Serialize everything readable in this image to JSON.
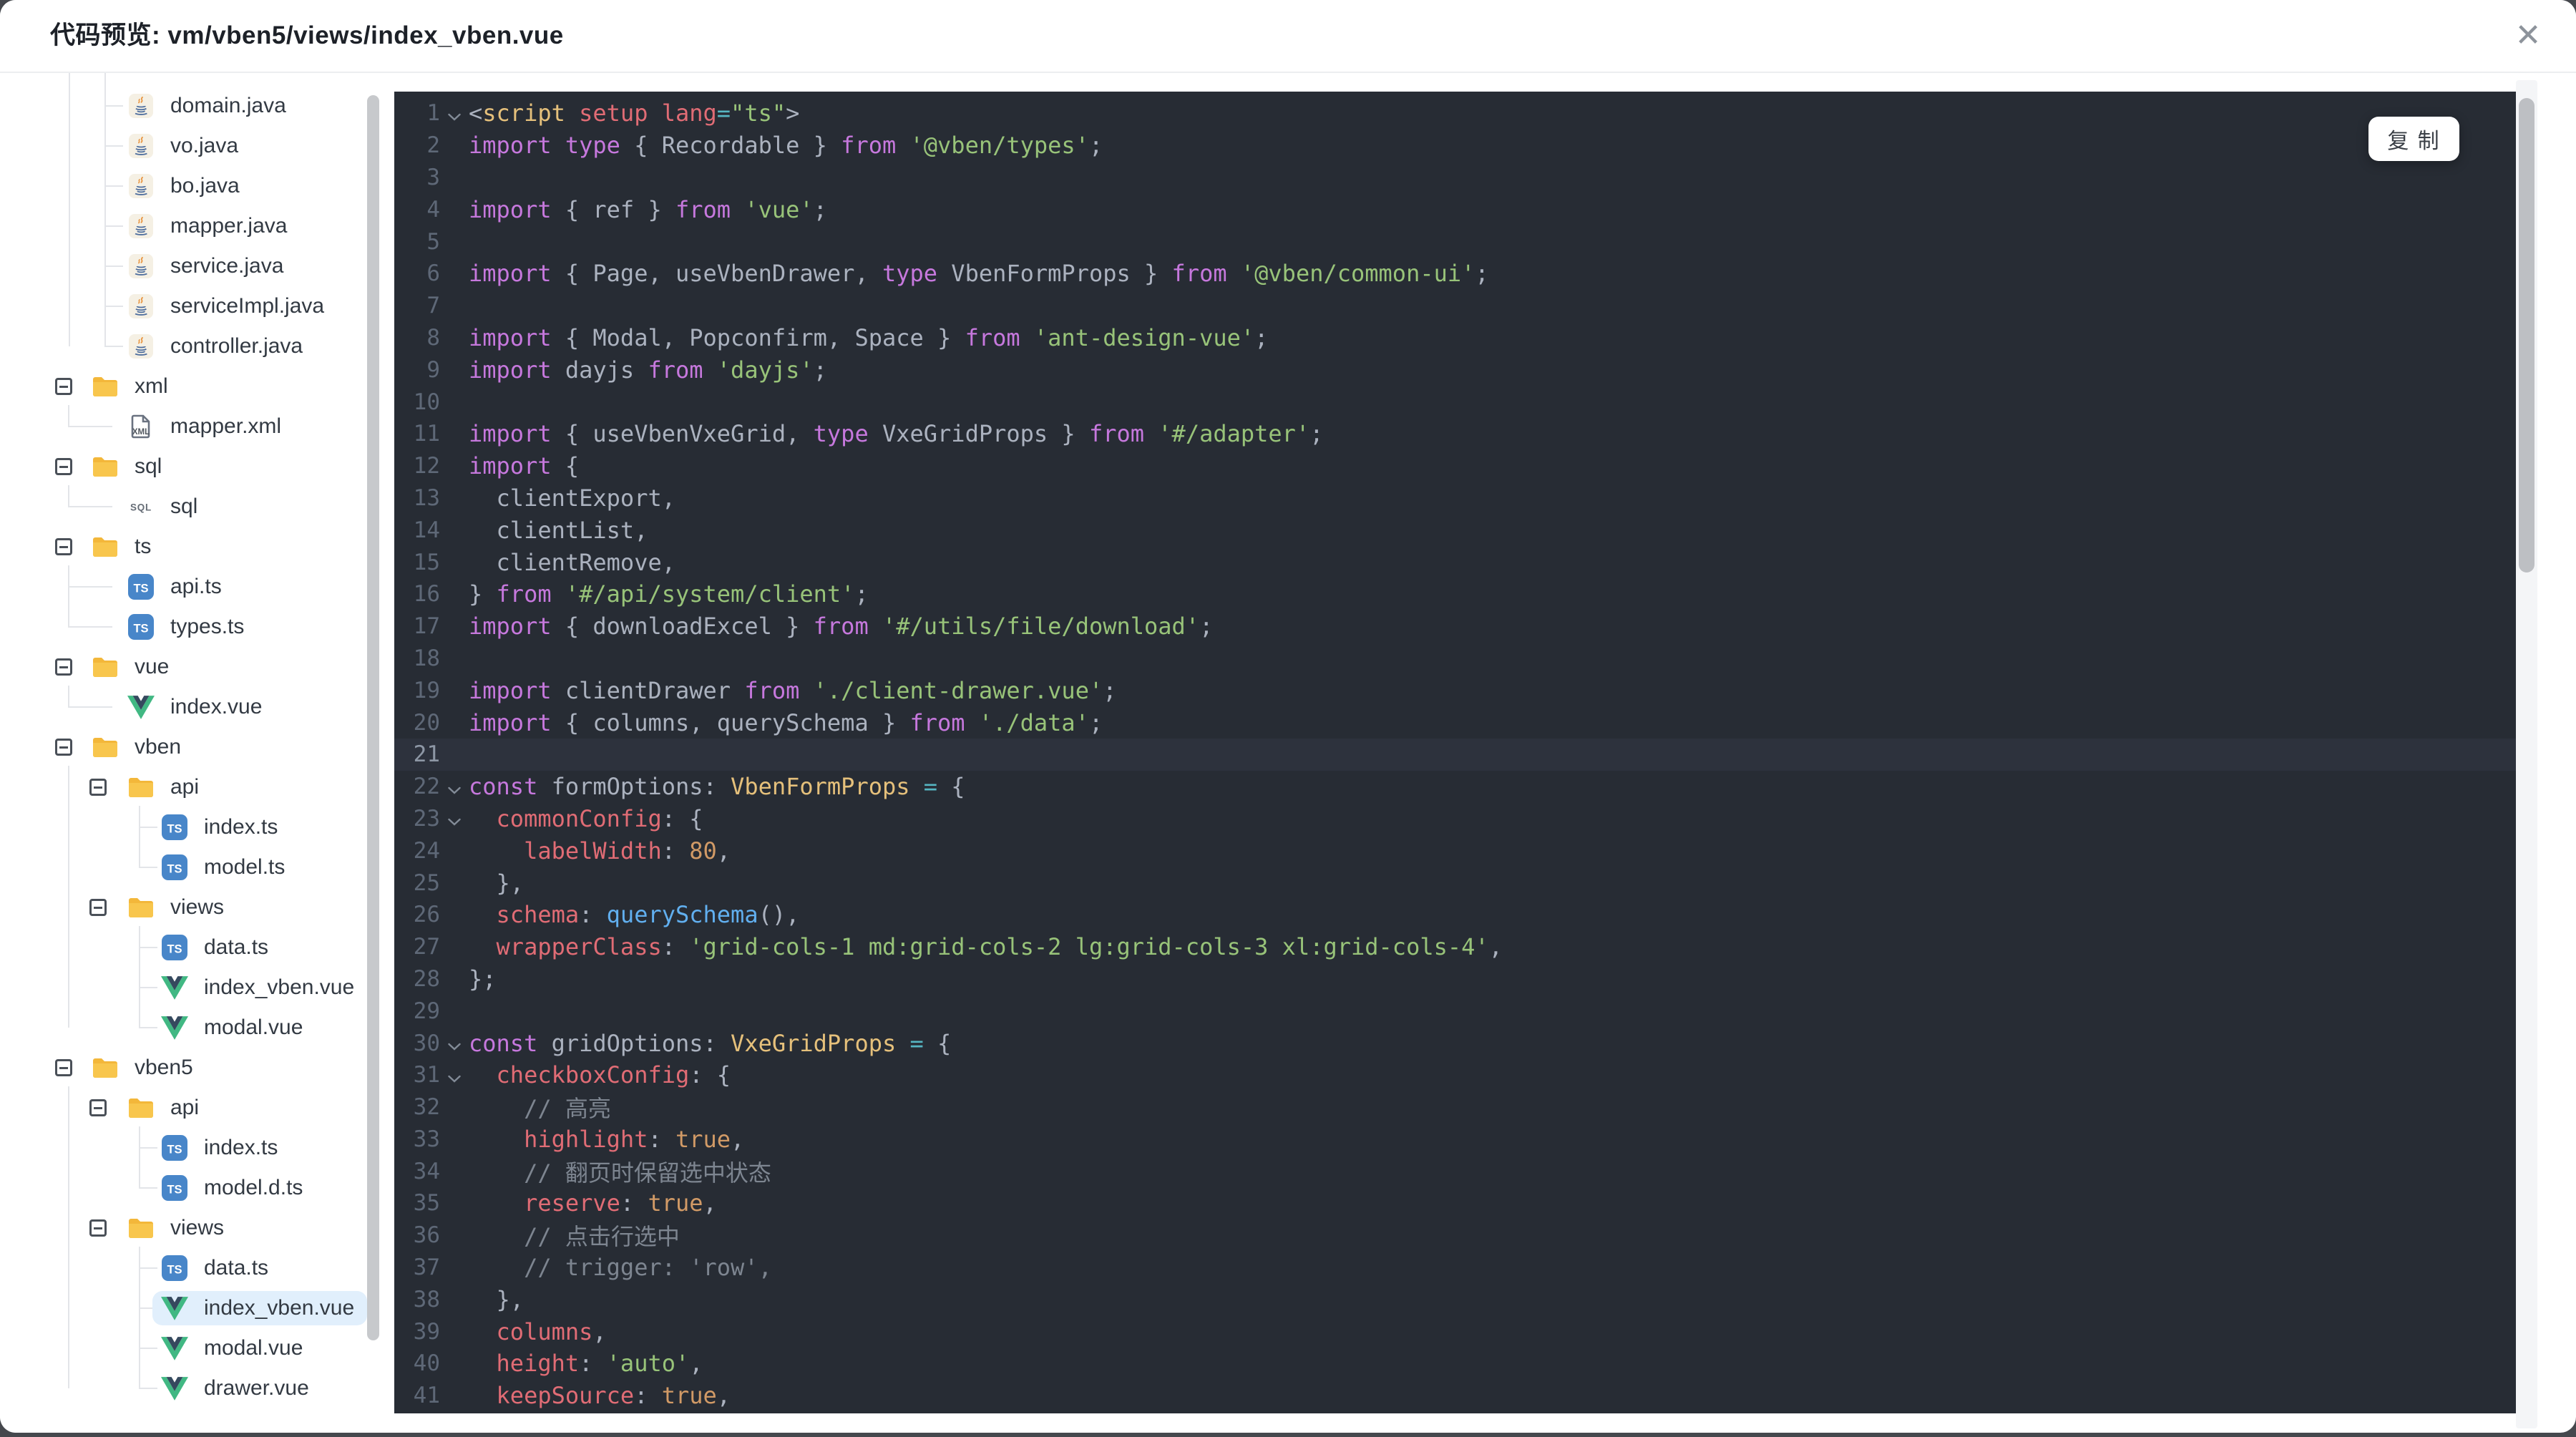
{
  "dialog": {
    "title": "代码预览: vm/vben5/views/index_vben.vue",
    "close_icon": "✕"
  },
  "copy_button": {
    "label": "复 制"
  },
  "tree": {
    "selected_bg": "#e1effc",
    "folder_color": "#f7c33c",
    "ts_color": "#4886c9",
    "vue_colors": {
      "outer": "#41b883",
      "inner": "#35495e"
    },
    "items": [
      {
        "name": "domain.java",
        "icon": "java",
        "depth": 1,
        "type": "file"
      },
      {
        "name": "vo.java",
        "icon": "java",
        "depth": 1,
        "type": "file"
      },
      {
        "name": "bo.java",
        "icon": "java",
        "depth": 1,
        "type": "file"
      },
      {
        "name": "mapper.java",
        "icon": "java",
        "depth": 1,
        "type": "file"
      },
      {
        "name": "service.java",
        "icon": "java",
        "depth": 1,
        "type": "file"
      },
      {
        "name": "serviceImpl.java",
        "icon": "java",
        "depth": 1,
        "type": "file"
      },
      {
        "name": "controller.java",
        "icon": "java",
        "depth": 1,
        "type": "file"
      },
      {
        "name": "xml",
        "icon": "folder",
        "depth": 0,
        "type": "folder",
        "toggle": true
      },
      {
        "name": "mapper.xml",
        "icon": "xml",
        "depth": 1,
        "type": "file"
      },
      {
        "name": "sql",
        "icon": "folder",
        "depth": 0,
        "type": "folder",
        "toggle": true
      },
      {
        "name": "sql",
        "icon": "sql",
        "depth": 1,
        "type": "file"
      },
      {
        "name": "ts",
        "icon": "folder",
        "depth": 0,
        "type": "folder",
        "toggle": true
      },
      {
        "name": "api.ts",
        "icon": "ts",
        "depth": 1,
        "type": "file"
      },
      {
        "name": "types.ts",
        "icon": "ts",
        "depth": 1,
        "type": "file"
      },
      {
        "name": "vue",
        "icon": "folder",
        "depth": 0,
        "type": "folder",
        "toggle": true
      },
      {
        "name": "index.vue",
        "icon": "vue",
        "depth": 1,
        "type": "file"
      },
      {
        "name": "vben",
        "icon": "folder",
        "depth": 0,
        "type": "folder",
        "toggle": true
      },
      {
        "name": "api",
        "icon": "folder",
        "depth": 1,
        "type": "folder",
        "toggle": true
      },
      {
        "name": "index.ts",
        "icon": "ts",
        "depth": 2,
        "type": "file"
      },
      {
        "name": "model.ts",
        "icon": "ts",
        "depth": 2,
        "type": "file"
      },
      {
        "name": "views",
        "icon": "folder",
        "depth": 1,
        "type": "folder",
        "toggle": true
      },
      {
        "name": "data.ts",
        "icon": "ts",
        "depth": 2,
        "type": "file"
      },
      {
        "name": "index_vben.vue",
        "icon": "vue",
        "depth": 2,
        "type": "file"
      },
      {
        "name": "modal.vue",
        "icon": "vue",
        "depth": 2,
        "type": "file"
      },
      {
        "name": "vben5",
        "icon": "folder",
        "depth": 0,
        "type": "folder",
        "toggle": true
      },
      {
        "name": "api",
        "icon": "folder",
        "depth": 1,
        "type": "folder",
        "toggle": true
      },
      {
        "name": "index.ts",
        "icon": "ts",
        "depth": 2,
        "type": "file"
      },
      {
        "name": "model.d.ts",
        "icon": "ts",
        "depth": 2,
        "type": "file"
      },
      {
        "name": "views",
        "icon": "folder",
        "depth": 1,
        "type": "folder",
        "toggle": true
      },
      {
        "name": "data.ts",
        "icon": "ts",
        "depth": 2,
        "type": "file"
      },
      {
        "name": "index_vben.vue",
        "icon": "vue",
        "depth": 2,
        "type": "file",
        "selected": true
      },
      {
        "name": "modal.vue",
        "icon": "vue",
        "depth": 2,
        "type": "file"
      },
      {
        "name": "drawer.vue",
        "icon": "vue",
        "depth": 2,
        "type": "file"
      }
    ]
  },
  "editor": {
    "background": "#272c34",
    "line_highlight": "#2d323d",
    "colors": {
      "p": "#c678dd",
      "t": "#abb2bf",
      "s": "#98c379",
      "r": "#e06c75",
      "y": "#e5c07b",
      "c": "#56b6c2",
      "b": "#61afef",
      "o": "#d19a66",
      "m": "#7d8590",
      "ln": "#5e6877"
    },
    "lines": [
      {
        "fold": true,
        "tokens": [
          [
            "t",
            "<"
          ],
          [
            "y",
            "script"
          ],
          [
            "t",
            " "
          ],
          [
            "r",
            "setup"
          ],
          [
            "t",
            " "
          ],
          [
            "r",
            "lang"
          ],
          [
            "c",
            "="
          ],
          [
            "s",
            "\"ts\""
          ],
          [
            "t",
            ">"
          ]
        ]
      },
      {
        "tokens": [
          [
            "p",
            "import"
          ],
          [
            "t",
            " "
          ],
          [
            "p",
            "type"
          ],
          [
            "t",
            " { Recordable } "
          ],
          [
            "p",
            "from"
          ],
          [
            "t",
            " "
          ],
          [
            "s",
            "'@vben/types'"
          ],
          [
            "t",
            ";"
          ]
        ]
      },
      {
        "tokens": []
      },
      {
        "tokens": [
          [
            "p",
            "import"
          ],
          [
            "t",
            " { ref } "
          ],
          [
            "p",
            "from"
          ],
          [
            "t",
            " "
          ],
          [
            "s",
            "'vue'"
          ],
          [
            "t",
            ";"
          ]
        ]
      },
      {
        "tokens": []
      },
      {
        "tokens": [
          [
            "p",
            "import"
          ],
          [
            "t",
            " { Page, useVbenDrawer, "
          ],
          [
            "p",
            "type"
          ],
          [
            "t",
            " VbenFormProps } "
          ],
          [
            "p",
            "from"
          ],
          [
            "t",
            " "
          ],
          [
            "s",
            "'@vben/common-ui'"
          ],
          [
            "t",
            ";"
          ]
        ]
      },
      {
        "tokens": []
      },
      {
        "tokens": [
          [
            "p",
            "import"
          ],
          [
            "t",
            " { Modal, Popconfirm, Space } "
          ],
          [
            "p",
            "from"
          ],
          [
            "t",
            " "
          ],
          [
            "s",
            "'ant-design-vue'"
          ],
          [
            "t",
            ";"
          ]
        ]
      },
      {
        "tokens": [
          [
            "p",
            "import"
          ],
          [
            "t",
            " dayjs "
          ],
          [
            "p",
            "from"
          ],
          [
            "t",
            " "
          ],
          [
            "s",
            "'dayjs'"
          ],
          [
            "t",
            ";"
          ]
        ]
      },
      {
        "tokens": []
      },
      {
        "tokens": [
          [
            "p",
            "import"
          ],
          [
            "t",
            " { useVbenVxeGrid, "
          ],
          [
            "p",
            "type"
          ],
          [
            "t",
            " VxeGridProps } "
          ],
          [
            "p",
            "from"
          ],
          [
            "t",
            " "
          ],
          [
            "s",
            "'#/adapter'"
          ],
          [
            "t",
            ";"
          ]
        ]
      },
      {
        "tokens": [
          [
            "p",
            "import"
          ],
          [
            "t",
            " {"
          ]
        ]
      },
      {
        "tokens": [
          [
            "t",
            "  clientExport,"
          ]
        ]
      },
      {
        "tokens": [
          [
            "t",
            "  clientList,"
          ]
        ]
      },
      {
        "tokens": [
          [
            "t",
            "  clientRemove,"
          ]
        ]
      },
      {
        "tokens": [
          [
            "t",
            "} "
          ],
          [
            "p",
            "from"
          ],
          [
            "t",
            " "
          ],
          [
            "s",
            "'#/api/system/client'"
          ],
          [
            "t",
            ";"
          ]
        ]
      },
      {
        "tokens": [
          [
            "p",
            "import"
          ],
          [
            "t",
            " { downloadExcel } "
          ],
          [
            "p",
            "from"
          ],
          [
            "t",
            " "
          ],
          [
            "s",
            "'#/utils/file/download'"
          ],
          [
            "t",
            ";"
          ]
        ]
      },
      {
        "tokens": []
      },
      {
        "tokens": [
          [
            "p",
            "import"
          ],
          [
            "t",
            " clientDrawer "
          ],
          [
            "p",
            "from"
          ],
          [
            "t",
            " "
          ],
          [
            "s",
            "'./client-drawer.vue'"
          ],
          [
            "t",
            ";"
          ]
        ]
      },
      {
        "tokens": [
          [
            "p",
            "import"
          ],
          [
            "t",
            " { columns, querySchema } "
          ],
          [
            "p",
            "from"
          ],
          [
            "t",
            " "
          ],
          [
            "s",
            "'./data'"
          ],
          [
            "t",
            ";"
          ]
        ]
      },
      {
        "hl": true,
        "tokens": []
      },
      {
        "fold": true,
        "tokens": [
          [
            "p",
            "const"
          ],
          [
            "t",
            " formOptions: "
          ],
          [
            "y",
            "VbenFormProps"
          ],
          [
            "t",
            " "
          ],
          [
            "c",
            "="
          ],
          [
            "t",
            " {"
          ]
        ]
      },
      {
        "fold": true,
        "tokens": [
          [
            "t",
            "  "
          ],
          [
            "r",
            "commonConfig"
          ],
          [
            "t",
            ": {"
          ]
        ]
      },
      {
        "tokens": [
          [
            "t",
            "    "
          ],
          [
            "r",
            "labelWidth"
          ],
          [
            "t",
            ": "
          ],
          [
            "o",
            "80"
          ],
          [
            "t",
            ","
          ]
        ]
      },
      {
        "tokens": [
          [
            "t",
            "  },"
          ]
        ]
      },
      {
        "tokens": [
          [
            "t",
            "  "
          ],
          [
            "r",
            "schema"
          ],
          [
            "t",
            ": "
          ],
          [
            "b",
            "querySchema"
          ],
          [
            "t",
            "(),"
          ]
        ]
      },
      {
        "tokens": [
          [
            "t",
            "  "
          ],
          [
            "r",
            "wrapperClass"
          ],
          [
            "t",
            ": "
          ],
          [
            "s",
            "'grid-cols-1 md:grid-cols-2 lg:grid-cols-3 xl:grid-cols-4'"
          ],
          [
            "t",
            ","
          ]
        ]
      },
      {
        "tokens": [
          [
            "t",
            "};"
          ]
        ]
      },
      {
        "tokens": []
      },
      {
        "fold": true,
        "tokens": [
          [
            "p",
            "const"
          ],
          [
            "t",
            " gridOptions: "
          ],
          [
            "y",
            "VxeGridProps"
          ],
          [
            "t",
            " "
          ],
          [
            "c",
            "="
          ],
          [
            "t",
            " {"
          ]
        ]
      },
      {
        "fold": true,
        "tokens": [
          [
            "t",
            "  "
          ],
          [
            "r",
            "checkboxConfig"
          ],
          [
            "t",
            ": {"
          ]
        ]
      },
      {
        "tokens": [
          [
            "t",
            "    "
          ],
          [
            "m",
            "// 高亮"
          ]
        ]
      },
      {
        "tokens": [
          [
            "t",
            "    "
          ],
          [
            "r",
            "highlight"
          ],
          [
            "t",
            ": "
          ],
          [
            "o",
            "true"
          ],
          [
            "t",
            ","
          ]
        ]
      },
      {
        "tokens": [
          [
            "t",
            "    "
          ],
          [
            "m",
            "// 翻页时保留选中状态"
          ]
        ]
      },
      {
        "tokens": [
          [
            "t",
            "    "
          ],
          [
            "r",
            "reserve"
          ],
          [
            "t",
            ": "
          ],
          [
            "o",
            "true"
          ],
          [
            "t",
            ","
          ]
        ]
      },
      {
        "tokens": [
          [
            "t",
            "    "
          ],
          [
            "m",
            "// 点击行选中"
          ]
        ]
      },
      {
        "tokens": [
          [
            "t",
            "    "
          ],
          [
            "m",
            "// trigger: 'row',"
          ]
        ]
      },
      {
        "tokens": [
          [
            "t",
            "  },"
          ]
        ]
      },
      {
        "tokens": [
          [
            "t",
            "  "
          ],
          [
            "r",
            "columns"
          ],
          [
            "t",
            ","
          ]
        ]
      },
      {
        "tokens": [
          [
            "t",
            "  "
          ],
          [
            "r",
            "height"
          ],
          [
            "t",
            ": "
          ],
          [
            "s",
            "'auto'"
          ],
          [
            "t",
            ","
          ]
        ]
      },
      {
        "tokens": [
          [
            "t",
            "  "
          ],
          [
            "r",
            "keepSource"
          ],
          [
            "t",
            ": "
          ],
          [
            "o",
            "true"
          ],
          [
            "t",
            ","
          ]
        ]
      }
    ]
  }
}
